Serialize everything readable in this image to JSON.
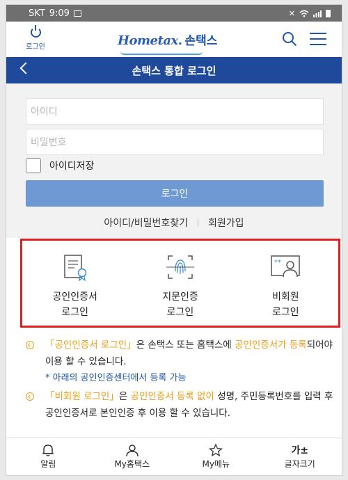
{
  "status_bar": {
    "carrier": "SKT",
    "time": "9:09"
  },
  "header": {
    "login_label": "로그인",
    "logo_home": "Hometax.",
    "logo_son": "손택스"
  },
  "title": "손택스 통합 로그인",
  "form": {
    "id_placeholder": "아이디",
    "password_placeholder": "비밀번호",
    "save_id_label": "아이디저장",
    "save_id_checked": false,
    "login_button": "로그인",
    "find_link": "아이디/비밀번호찾기",
    "signup_link": "회원가입"
  },
  "options": [
    {
      "line1": "공인인증서",
      "line2": "로그인",
      "icon": "certificate-icon"
    },
    {
      "line1": "지문인증",
      "line2": "로그인",
      "icon": "fingerprint-icon"
    },
    {
      "line1": "비회원",
      "line2": "로그인",
      "icon": "guest-user-icon"
    }
  ],
  "notes": {
    "note1": {
      "hl1": "「공인인증서 로그인」",
      "t1": "은 손택스 또는 홈택스에 ",
      "hl2": "공인인증서가 등록",
      "t2": "되어야 이용 할 수 있습니다.",
      "sub": "* 아래의 공인인증센터에서 등록 가능"
    },
    "note2": {
      "hl1": "「비회원 로그인」",
      "t1": "은 ",
      "hl2": "공인인증서 등록 없이",
      "t2": " 성명, 주민등록번호를 입력 후 공인인증서로 본인인증 후 이용 할 수 있습니다."
    }
  },
  "bottom_nav": [
    {
      "label": "알림",
      "icon": "bell-icon"
    },
    {
      "label": "My홈택스",
      "icon": "person-icon"
    },
    {
      "label": "My메뉴",
      "icon": "star-icon"
    },
    {
      "label": "글자크기",
      "icon_text": "가±",
      "icon": "font-size-icon"
    }
  ],
  "colors": {
    "primary": "#1f4a9b",
    "login_button": "#6e99d2",
    "highlight": "#e8a019",
    "highlight_box": "#e11d1d"
  }
}
